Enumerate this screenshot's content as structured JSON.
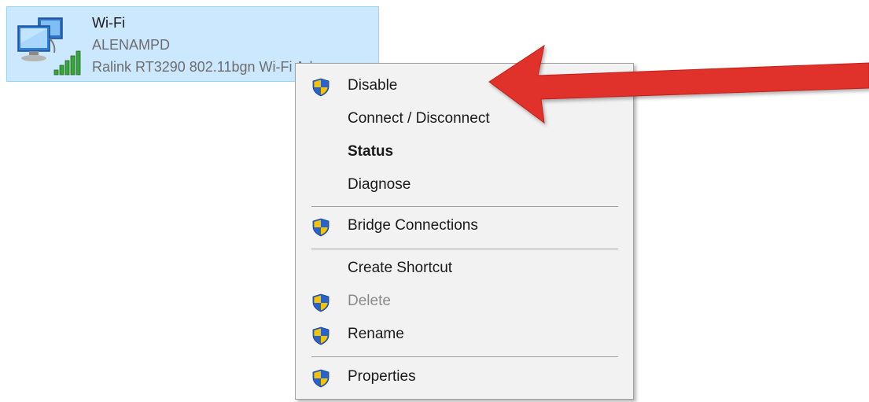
{
  "adapter": {
    "name": "Wi-Fi",
    "network": "ALENAMPD",
    "device": "Ralink RT3290 802.11bgn Wi-Fi Ad",
    "icon": "network-computer-icon",
    "signal_icon": "wifi-signal-bars-icon"
  },
  "context_menu": {
    "items": [
      {
        "label": "Disable",
        "icon": "uac-shield-icon"
      },
      {
        "label": "Connect / Disconnect"
      },
      {
        "label": "Status",
        "default": true
      },
      {
        "label": "Diagnose"
      },
      {
        "label": "Bridge Connections",
        "icon": "uac-shield-icon"
      },
      {
        "label": "Create Shortcut"
      },
      {
        "label": "Delete",
        "icon": "uac-shield-icon",
        "disabled": true
      },
      {
        "label": "Rename",
        "icon": "uac-shield-icon"
      },
      {
        "label": "Properties",
        "icon": "uac-shield-icon"
      }
    ]
  },
  "annotation": {
    "type": "arrow",
    "color": "#e0302a",
    "points_to": "Disable"
  },
  "colors": {
    "selection_bg": "#cce8ff",
    "selection_border": "#99d1ff",
    "menu_bg": "#f2f2f2",
    "shield_blue": "#2a62c9",
    "shield_yellow": "#f5c400",
    "signal_green": "#3aa33a"
  }
}
